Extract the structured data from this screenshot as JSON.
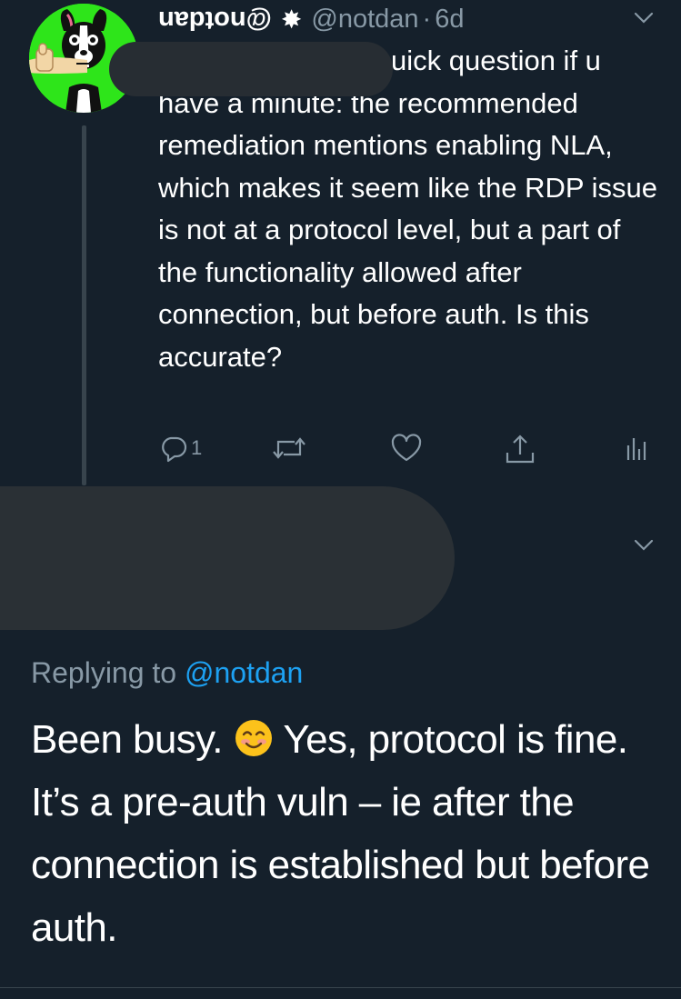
{
  "tweet": {
    "display_name": "@notdan",
    "badge_icon": "asterisk-badge-icon",
    "handle": "@notdan",
    "separator": "·",
    "timestamp": "6d",
    "text_lead": "uick question if u",
    "text_rest": "have a minute: the recommended remediation mentions enabling NLA, which makes it seem like the RDP issue is not at a protocol level, but a part of the functionality allowed after connection, but before auth. Is this accurate?",
    "actions": {
      "reply_count": "1",
      "icons": [
        "reply-icon",
        "retweet-icon",
        "like-icon",
        "share-icon",
        "analytics-icon"
      ]
    }
  },
  "reply": {
    "replying_label": "Replying to",
    "replying_handle": "@notdan",
    "text_before_emoji": "Been busy.",
    "emoji_icon": "smiling-face-emoji",
    "text_after_emoji": "Yes, protocol is fine. It’s a pre-auth vuln – ie after the connection is established but before auth."
  },
  "colors": {
    "background": "#15202b",
    "muted_text": "#8899a6",
    "link": "#1da1f2",
    "avatar_bg": "#2ee51a",
    "redaction": "#2a3035"
  }
}
